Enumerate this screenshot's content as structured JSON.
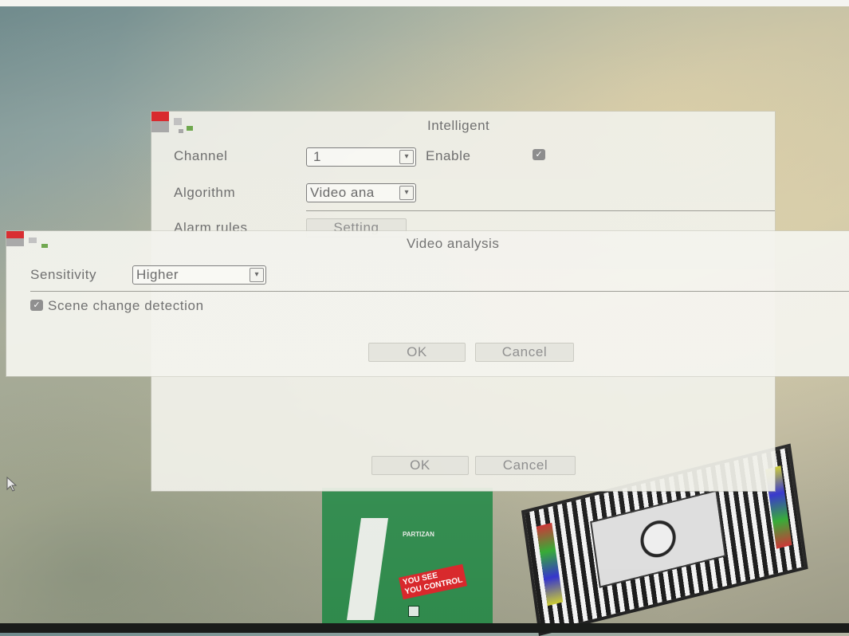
{
  "colors": {
    "dialog_bg": "#f0f0e8",
    "logo_red": "#d8262a",
    "logo_gray": "#a6a6a6",
    "logo_green": "#6ca64a",
    "text": "#6b6b6b"
  },
  "intelligent": {
    "title": "Intelligent",
    "channel_label": "Channel",
    "channel_value": "1",
    "enable_label": "Enable",
    "enable_checked": true,
    "algorithm_label": "Algorithm",
    "algorithm_value": "Video ana",
    "alarm_rules_label": "Alarm rules",
    "setting_button": "Setting",
    "ok_button": "OK",
    "cancel_button": "Cancel"
  },
  "video_analysis": {
    "title": "Video analysis",
    "sensitivity_label": "Sensitivity",
    "sensitivity_value": "Higher",
    "scene_change_label": "Scene change detection",
    "scene_change_checked": true,
    "ok_button": "OK",
    "cancel_button": "Cancel"
  },
  "background": {
    "poster_line1": "YOU SEE",
    "poster_line2": "YOU CONTROL",
    "poster_brand": "PARTIZAN"
  },
  "icons": {
    "dropdown": "chevron-down-icon",
    "check": "checkmark-icon",
    "cursor": "mouse-pointer-icon"
  }
}
